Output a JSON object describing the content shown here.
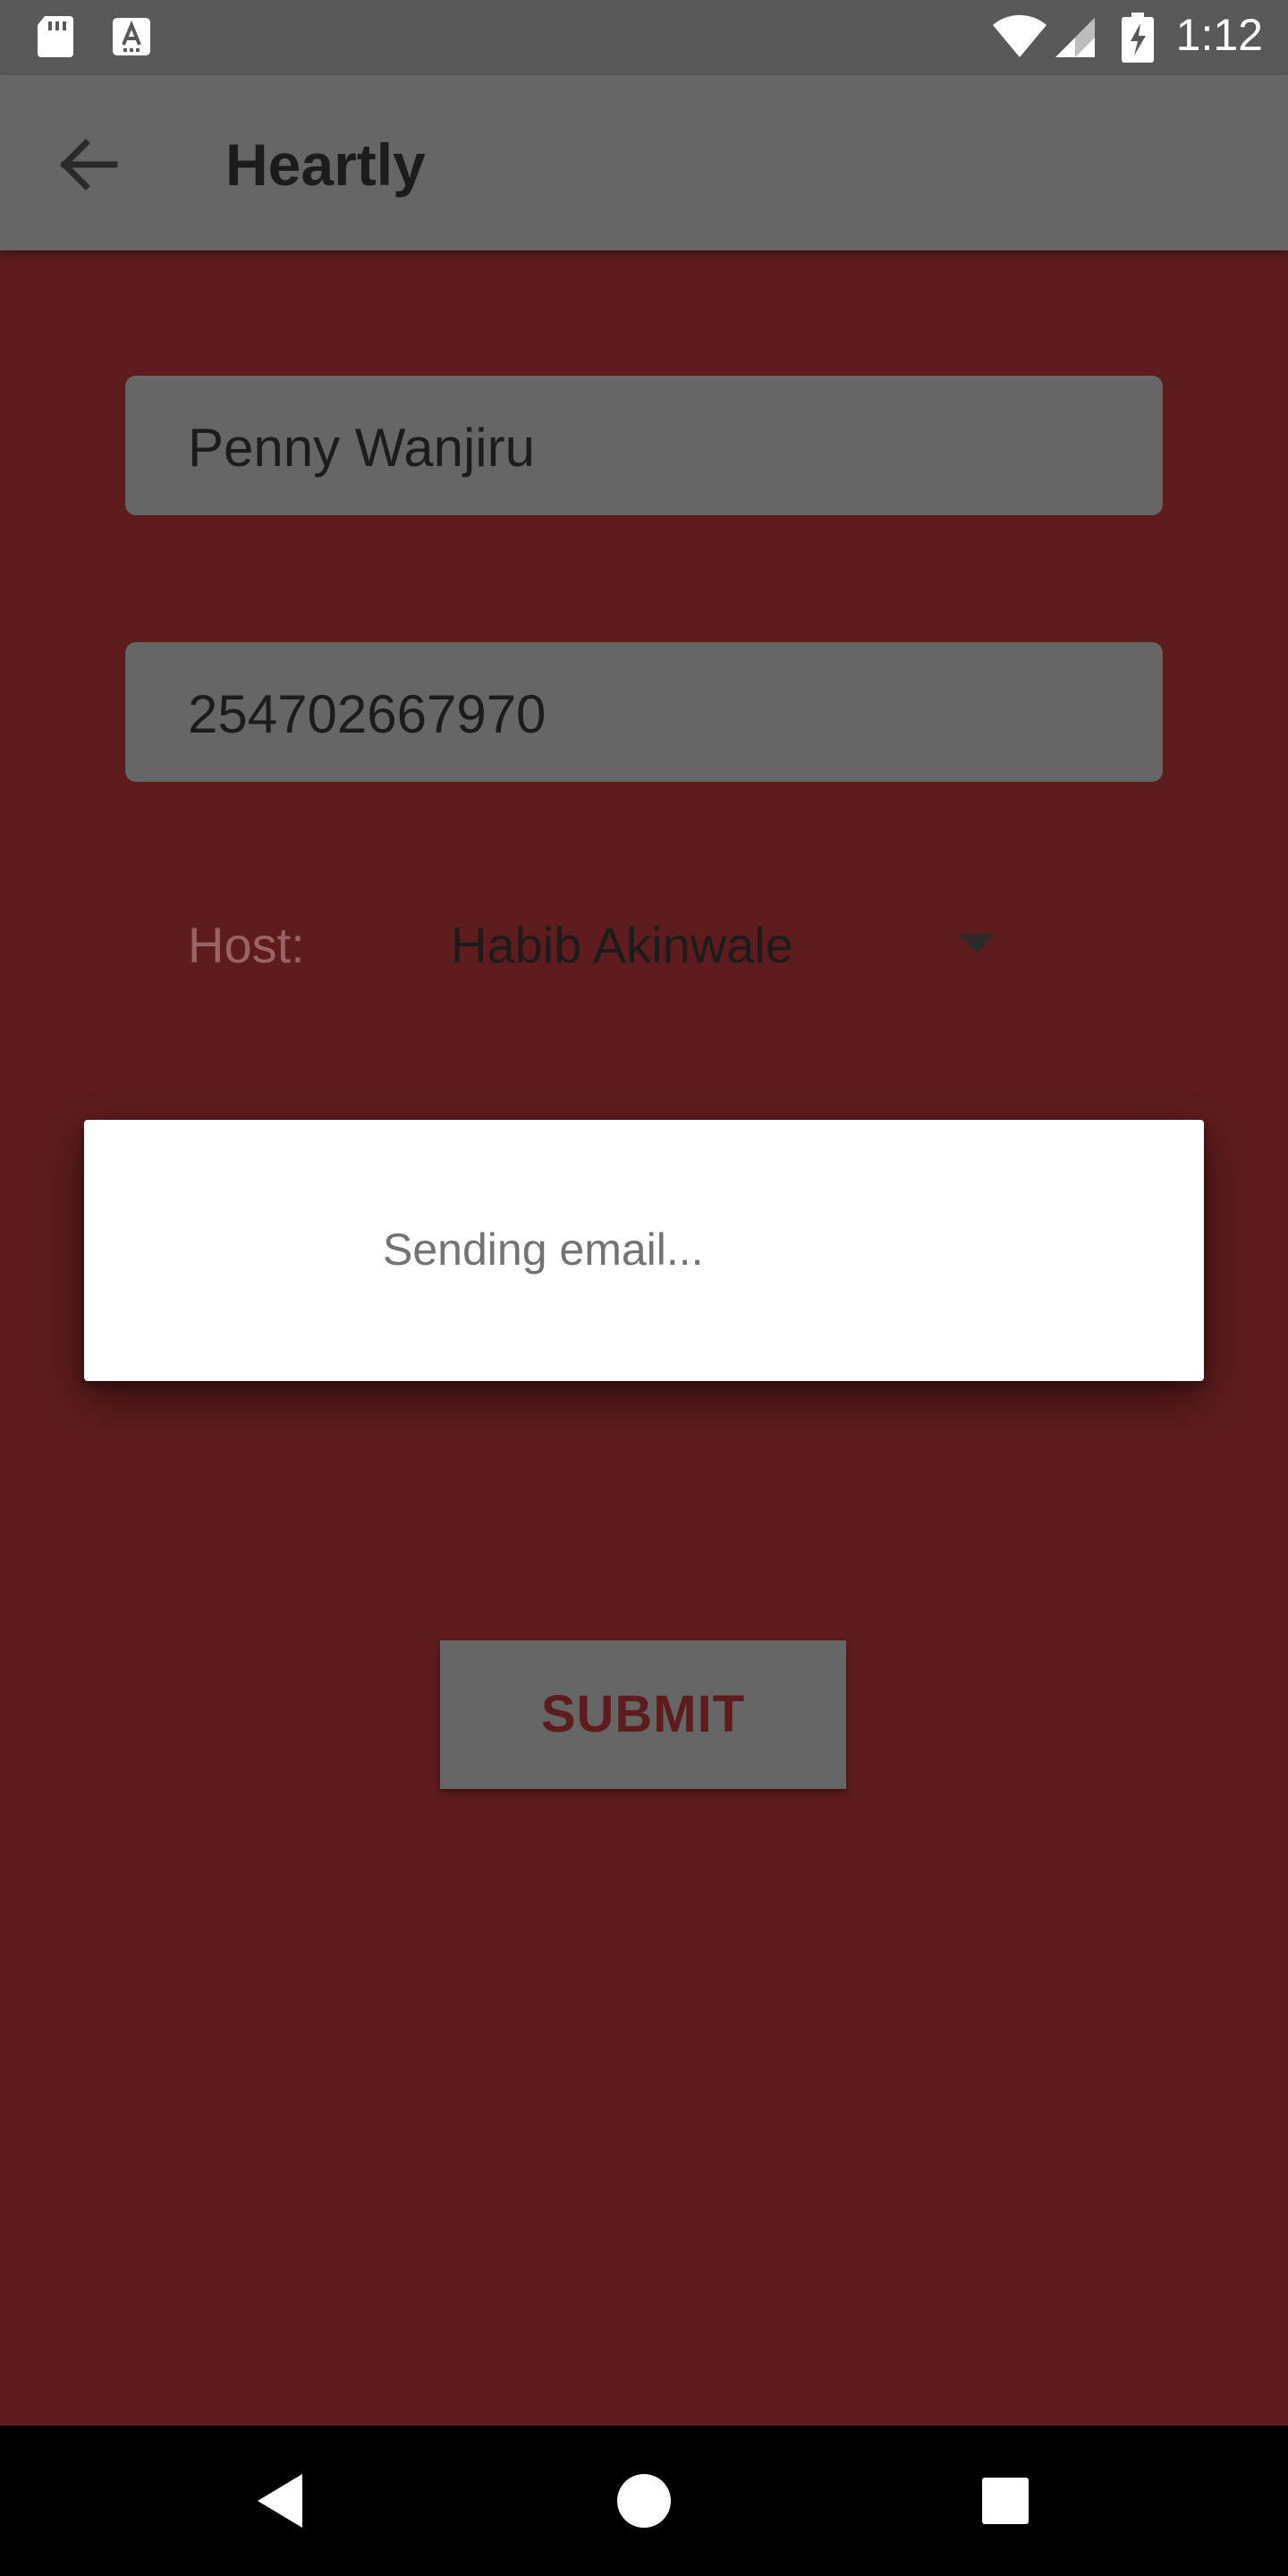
{
  "status_bar": {
    "time": "1:12",
    "icons": [
      "sd-card-icon",
      "keyboard-a-icon",
      "wifi-icon",
      "cell-signal-icon",
      "battery-charging-icon"
    ]
  },
  "app_bar": {
    "title": "Heartly",
    "back_icon": "arrow-back-icon"
  },
  "form": {
    "name_value": "Penny Wanjiru",
    "phone_value": "254702667970",
    "host_label": "Host:",
    "host_selected": "Habib Akinwale",
    "submit_label": "SUBMIT"
  },
  "dialog": {
    "message": "Sending email..."
  },
  "nav_bar": {
    "icons": [
      "nav-back-icon",
      "nav-home-icon",
      "nav-recents-icon"
    ]
  },
  "colors": {
    "background": "#5e1c1e",
    "app_bar": "#666666",
    "status_bar": "#595959",
    "field": "#666666",
    "dialog": "#ffffff",
    "nav_bar": "#000000"
  }
}
